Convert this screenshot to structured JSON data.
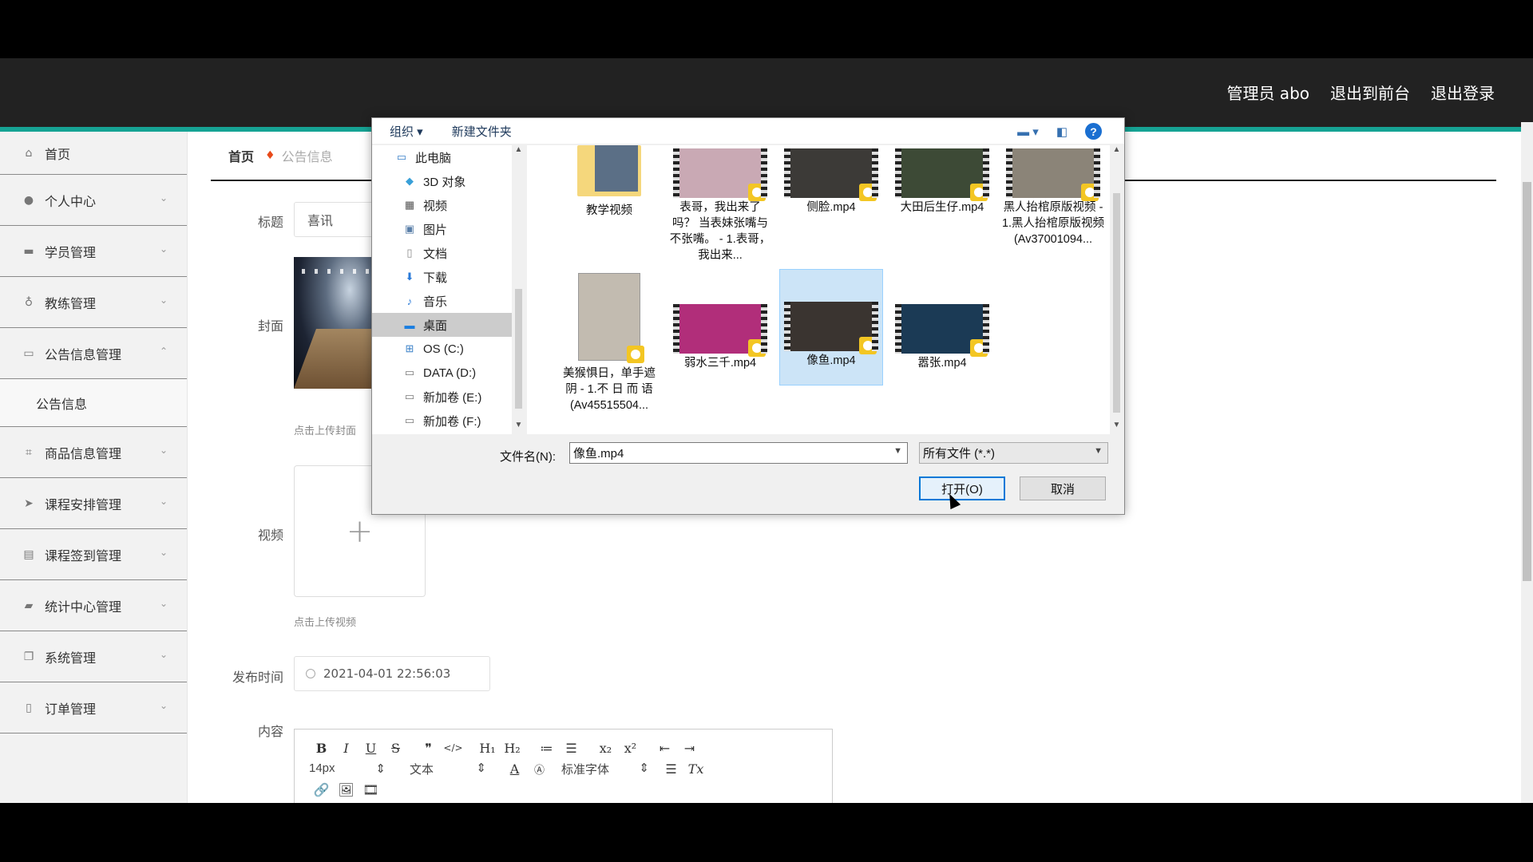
{
  "header": {
    "admin_label": "管理员 abo",
    "back_front_label": "退出到前台",
    "logout_label": "退出登录",
    "accent_color": "#16a394"
  },
  "sidebar": {
    "items": [
      {
        "label": "首页",
        "icon": "home-icon"
      },
      {
        "label": "个人中心",
        "icon": "user-icon"
      },
      {
        "label": "学员管理",
        "icon": "briefcase-icon"
      },
      {
        "label": "教练管理",
        "icon": "microphone-icon"
      },
      {
        "label": "公告信息管理",
        "icon": "message-icon",
        "expanded": true
      },
      {
        "label": "公告信息",
        "sub": true
      },
      {
        "label": "商品信息管理",
        "icon": "crop-icon"
      },
      {
        "label": "课程安排管理",
        "icon": "send-icon"
      },
      {
        "label": "课程签到管理",
        "icon": "clipboard-icon"
      },
      {
        "label": "统计中心管理",
        "icon": "ticket-icon"
      },
      {
        "label": "系统管理",
        "icon": "copy-icon"
      },
      {
        "label": "订单管理",
        "icon": "mobile-icon"
      }
    ]
  },
  "breadcrumb": {
    "home": "首页",
    "current": "公告信息"
  },
  "form": {
    "title_label": "标题",
    "title_value": "喜讯",
    "cover_label": "封面",
    "cover_hint": "点击上传封面",
    "video_label": "视频",
    "video_hint": "点击上传视频",
    "plus_glyph": "+",
    "date_label": "发布时间",
    "date_value": "2021-04-01 22:56:03",
    "content_label": "内容"
  },
  "editor": {
    "row1": [
      "B",
      "I",
      "U",
      "S",
      "❞",
      "</>",
      "H₁",
      "H₂",
      "≔",
      "☰",
      "x₂",
      "x²",
      "⇤",
      "⇥"
    ],
    "font_size": "14px",
    "text_type": "文本",
    "font_family": "标准字体",
    "row3": [
      "🔗",
      "🖼",
      "🎞"
    ]
  },
  "dialog": {
    "organize": "组织 ▾",
    "new_folder": "新建文件夹",
    "help": "?",
    "nav": [
      {
        "label": "此电脑",
        "icon": "computer-icon",
        "root": true
      },
      {
        "label": "3D 对象",
        "icon": "cube-icon"
      },
      {
        "label": "视频",
        "icon": "video-folder-icon"
      },
      {
        "label": "图片",
        "icon": "picture-icon"
      },
      {
        "label": "文档",
        "icon": "document-icon"
      },
      {
        "label": "下载",
        "icon": "download-icon"
      },
      {
        "label": "音乐",
        "icon": "music-icon"
      },
      {
        "label": "桌面",
        "icon": "desktop-icon",
        "selected": true
      },
      {
        "label": "OS (C:)",
        "icon": "drive-icon"
      },
      {
        "label": "DATA (D:)",
        "icon": "drive-icon"
      },
      {
        "label": "新加卷 (E:)",
        "icon": "drive-icon"
      },
      {
        "label": "新加卷 (F:)",
        "icon": "drive-icon"
      }
    ],
    "files": [
      {
        "name": "教学视频",
        "kind": "folder"
      },
      {
        "name": "表哥，我出来了吗？ 当表妹张嘴与不张嘴。 - 1.表哥，我出来...",
        "kind": "video",
        "tint": "#c9a9b4"
      },
      {
        "name": "侧脸.mp4",
        "kind": "video",
        "tint": "#3c3a37"
      },
      {
        "name": "大田后生仔.mp4",
        "kind": "video",
        "tint": "#3d4a36"
      },
      {
        "name": "黑人抬棺原版视频 - 1.黑人抬棺原版视频 (Av37001094...",
        "kind": "video",
        "tint": "#8b8478"
      },
      {
        "name": "美猴惧日，单手遮阴 - 1.不 日 而 语 (Av45515504...",
        "kind": "video-tall",
        "tint": "#c2bbb0"
      },
      {
        "name": "弱水三千.mp4",
        "kind": "video",
        "tint": "#b12e7a"
      },
      {
        "name": "像鱼.mp4",
        "kind": "video",
        "tint": "#3a3430",
        "selected": true
      },
      {
        "name": "嚣张.mp4",
        "kind": "video",
        "tint": "#1b3a55"
      }
    ],
    "filename_label": "文件名(N):",
    "filename_value": "像鱼.mp4",
    "filetype_value": "所有文件 (*.*)",
    "open_label": "打开(O)",
    "cancel_label": "取消"
  }
}
